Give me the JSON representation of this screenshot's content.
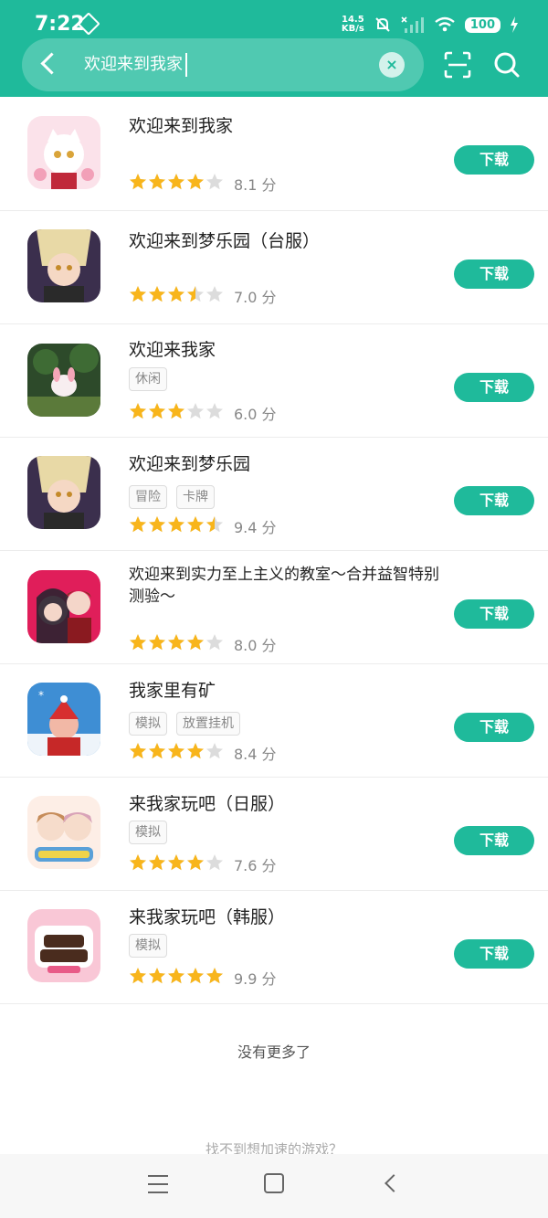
{
  "status_bar": {
    "time": "7:22",
    "net_speed_value": "14.5",
    "net_speed_unit": "KB/s",
    "battery": "100"
  },
  "search": {
    "query": "欢迎来到我家",
    "clear_label": "×"
  },
  "icons": {
    "back": "chevron-left-icon",
    "clear": "close-icon",
    "scan": "scan-icon",
    "search": "search-icon"
  },
  "colors": {
    "brand": "#1fba9b",
    "star": "#f8b51b",
    "star_empty": "#dcdcdc"
  },
  "results": [
    {
      "title": "欢迎来到我家",
      "tags": [],
      "rating": 4,
      "score": "8.1 分",
      "button": "下载"
    },
    {
      "title": "欢迎来到梦乐园（台服）",
      "tags": [],
      "rating": 3.5,
      "score": "7.0 分",
      "button": "下载"
    },
    {
      "title": "欢迎来我家",
      "tags": [
        "休闲"
      ],
      "rating": 3,
      "score": "6.0 分",
      "button": "下载"
    },
    {
      "title": "欢迎来到梦乐园",
      "tags": [
        "冒险",
        "卡牌"
      ],
      "rating": 4.5,
      "score": "9.4 分",
      "button": "下载"
    },
    {
      "title": "欢迎来到实力至上主义的教室～合并益智特别测验～",
      "tags": [],
      "rating": 4,
      "score": "8.0 分",
      "button": "下载"
    },
    {
      "title": "我家里有矿",
      "tags": [
        "模拟",
        "放置挂机"
      ],
      "rating": 4,
      "score": "8.4 分",
      "button": "下载"
    },
    {
      "title": "来我家玩吧（日服）",
      "tags": [
        "模拟"
      ],
      "rating": 4,
      "score": "7.6 分",
      "button": "下载"
    },
    {
      "title": "来我家玩吧（韩服）",
      "tags": [
        "模拟"
      ],
      "rating": 5,
      "score": "9.9 分",
      "button": "下载"
    }
  ],
  "list_end_text": "没有更多了",
  "footer_hint": "找不到想加速的游戏？"
}
